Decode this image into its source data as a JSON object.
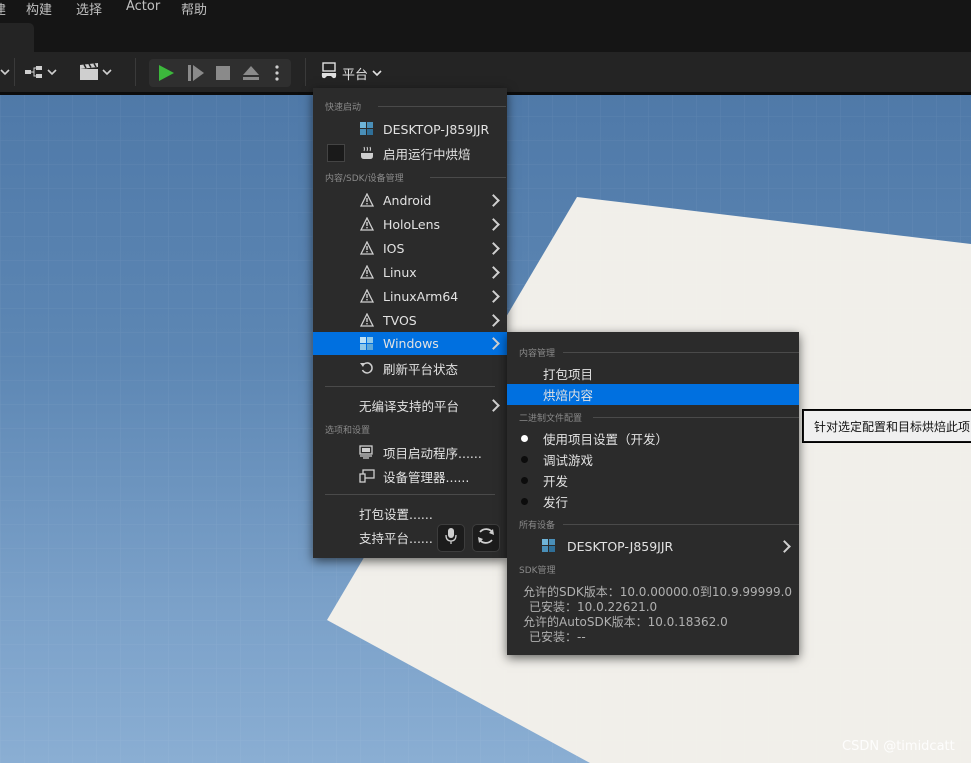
{
  "menubar": {
    "items": [
      "建",
      "构建",
      "选择",
      "Actor",
      "帮助"
    ]
  },
  "toolbar": {
    "platform_label": "平台"
  },
  "platform_menu": {
    "sections": {
      "quick_launch": "快速启动",
      "content_sdk": "内容/SDK/设备管理",
      "options": "选项和设置"
    },
    "quick_launch_device": "DESKTOP-J859JJR",
    "cook_on_the_fly": "启用运行中烘焙",
    "platforms": [
      "Android",
      "HoloLens",
      "IOS",
      "Linux",
      "LinuxArm64",
      "TVOS",
      "Windows"
    ],
    "refresh": "刷新平台状态",
    "no_compile": "无编译支持的平台",
    "project_launcher": "项目启动程序......",
    "device_manager": "设备管理器......",
    "packaging_settings": "打包设置......",
    "supported_platforms": "支持平台......"
  },
  "windows_submenu": {
    "sections": {
      "content": "内容管理",
      "binary": "二进制文件配置",
      "devices": "所有设备",
      "sdk": "SDK管理"
    },
    "package_project": "打包项目",
    "cook_content": "烘焙内容",
    "binary_configs": [
      "使用项目设置（开发）",
      "调试游戏",
      "开发",
      "发行"
    ],
    "device": "DESKTOP-J859JJR",
    "sdk_lines": [
      "允许的SDK版本：10.0.00000.0到10.9.99999.0",
      "已安装：10.0.22621.0",
      "允许的AutoSDK版本：10.0.18362.0",
      "已安装：--"
    ]
  },
  "tooltip": "针对选定配置和目标烘焙此项目的内容",
  "watermark": "CSDN @timidcatt",
  "colors": {
    "highlight": "#0070e0",
    "play_green": "#3cb83c",
    "menu_bg": "#2b2b2b"
  }
}
